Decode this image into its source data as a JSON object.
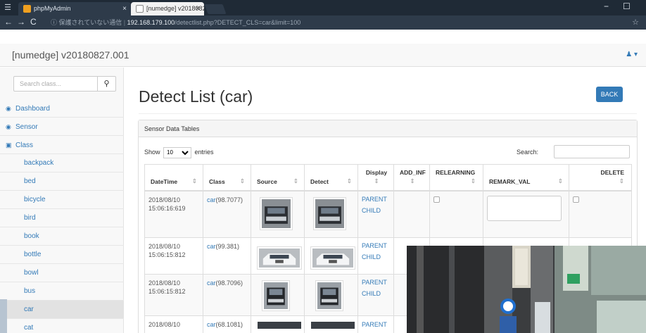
{
  "browser": {
    "tabs": [
      {
        "title": "phpMyAdmin",
        "close": "×"
      },
      {
        "title": "[numedge] v20180827.00",
        "close": "×"
      }
    ],
    "nav": {
      "back": "←",
      "forward": "→",
      "reload": "C"
    },
    "url": {
      "security": "ⓘ 保護されていない通信",
      "host": "192.168.179.100",
      "path": "/detectlist.php?DETECT_CLS=car&limit=100"
    }
  },
  "app": {
    "brand": "[numedge] v20180827.001",
    "user_caret": "▾"
  },
  "sidebar": {
    "search_placeholder": "Search class...",
    "items": [
      {
        "label": "Dashboard",
        "icon": "dashboard-icon"
      },
      {
        "label": "Sensor",
        "icon": "eye-icon"
      },
      {
        "label": "Class",
        "icon": "car-icon"
      }
    ],
    "classes": [
      "backpack",
      "bed",
      "bicycle",
      "bird",
      "book",
      "bottle",
      "bowl",
      "bus",
      "car",
      "cat"
    ],
    "active_class": "car"
  },
  "main": {
    "title": "Detect List (car)",
    "back_label": "BACK",
    "panel_title": "Sensor Data Tables",
    "show_prefix": "Show",
    "show_value": "10",
    "show_suffix": "entries",
    "search_label": "Search:",
    "columns": [
      "DateTime",
      "Class",
      "Source",
      "Detect",
      "Display",
      "ADD_INF",
      "RELEARNING",
      "REMARK_VAL",
      "DELETE"
    ],
    "rows": [
      {
        "date": "2018/08/10",
        "time": "15:06:16:619",
        "class": "car",
        "score": "(98.7077)",
        "display": [
          "PARENT",
          "CHILD"
        ],
        "img": "front"
      },
      {
        "date": "2018/08/10",
        "time": "15:06:15:812",
        "class": "car",
        "score": "(99.381)",
        "display": [
          "PARENT",
          "CHILD"
        ],
        "img": "white"
      },
      {
        "date": "2018/08/10",
        "time": "15:06:15:812",
        "class": "car",
        "score": "(98.7096)",
        "display": [
          "PARENT",
          "CHILD"
        ],
        "img": "front"
      },
      {
        "date": "2018/08/10",
        "time": "",
        "class": "car",
        "score": "(68.1081)",
        "display": [
          "PARENT"
        ],
        "img": "dark"
      }
    ]
  },
  "colors": {
    "link": "#337ab7",
    "accent": "#337ab7",
    "chrome": "#2e3b4a"
  }
}
